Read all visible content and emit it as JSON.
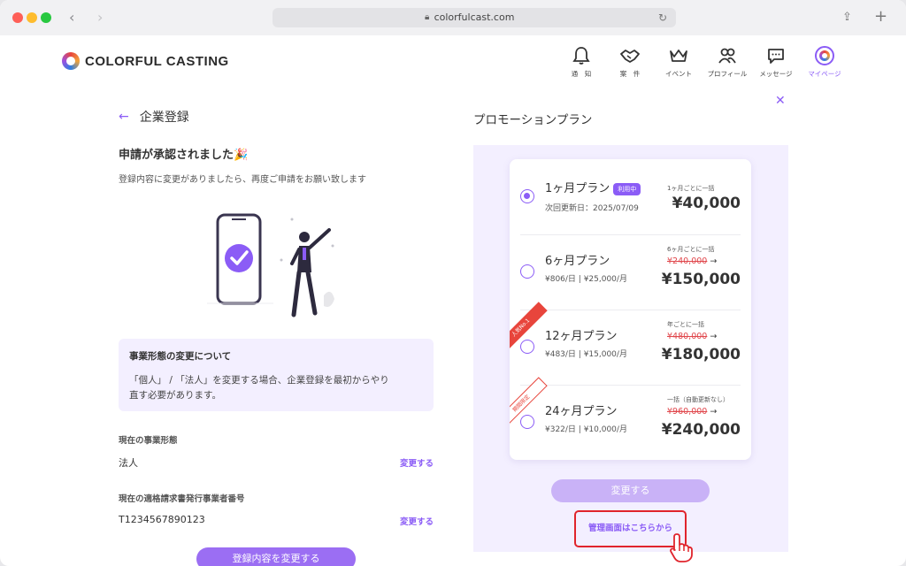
{
  "browser": {
    "url": "colorfulcast.com"
  },
  "header": {
    "logo_text_1": "C",
    "logo_text_2": "OLORFUL CASTING",
    "menu": [
      {
        "label": "通　知",
        "icon": "bell-icon"
      },
      {
        "label": "案　件",
        "icon": "handshake-icon"
      },
      {
        "label": "イベント",
        "icon": "crown-icon"
      },
      {
        "label": "プロフィール",
        "icon": "profile-icon"
      },
      {
        "label": "メッセージ",
        "icon": "message-icon"
      },
      {
        "label": "マイページ",
        "icon": "mypage-icon",
        "active": true
      }
    ]
  },
  "left": {
    "page_title": "企業登録",
    "approved_title": "申請が承認されました🎉",
    "approved_sub": "登録内容に変更がありましたら、再度ご申請をお願い致します",
    "notice_title": "事業形態の変更について",
    "notice_body_1": "「個人」 / 「法人」を変更する場合、企業登録を最初からやり",
    "notice_body_2": "直す必要があります。",
    "field1_label": "現在の事業形態",
    "field1_value": "法人",
    "field2_label": "現在の適格請求書発行事業者番号",
    "field2_value": "T1234567890123",
    "change_link": "変更する",
    "main_button": "登録内容を変更する"
  },
  "promo": {
    "title": "プロモーションプラン",
    "plans": [
      {
        "name": "1ヶ月プラン",
        "badge": "利用中",
        "sub": "次回更新日：2025/07/09",
        "note": "1ヶ月ごとに一括",
        "old": "",
        "price": "¥40,000",
        "selected": true
      },
      {
        "name": "6ヶ月プラン",
        "sub": "¥806/日 | ¥25,000/月",
        "note": "6ヶ月ごとに一括",
        "old": "¥240,000",
        "price": "¥150,000"
      },
      {
        "name": "12ヶ月プラン",
        "sub": "¥483/日 | ¥15,000/月",
        "note": "年ごとに一括",
        "old": "¥480,000",
        "price": "¥180,000",
        "ribbon": "人気No.1"
      },
      {
        "name": "24ヶ月プラン",
        "sub": "¥322/日 | ¥10,000/月",
        "note": "一括（自動更新なし）",
        "old": "¥960,000",
        "price": "¥240,000",
        "ribbon": "期間限定"
      }
    ],
    "arrow": "→",
    "change_button": "変更する",
    "admin_link": "管理画面はこちらから"
  },
  "colors": {
    "accent": "#8b5cf6",
    "panel": "#f3efff",
    "highlight": "#e0242c"
  }
}
